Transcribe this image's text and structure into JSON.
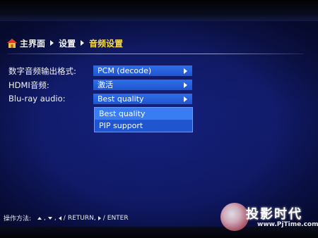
{
  "breadcrumb": {
    "items": [
      "主界面",
      "设置",
      "音频设置"
    ]
  },
  "settings": {
    "rows": [
      {
        "label": "数字音频输出格式:",
        "value": "PCM (decode)"
      },
      {
        "label": "HDMI音频:",
        "value": "激活"
      },
      {
        "label": "Blu-ray audio:",
        "value": "Best quality"
      }
    ]
  },
  "dropdown": {
    "options": [
      "Best quality",
      "PIP support"
    ],
    "selected": "Best quality"
  },
  "footer": {
    "label": "操作方法:",
    "return_text": "RETURN,",
    "enter_text": "ENTER"
  },
  "watermark": {
    "brand": "投影时代",
    "url": "www.PjTime.com"
  },
  "colors": {
    "background": "#101a66",
    "value_box": "#1f55cf",
    "highlight": "#3a7cf2",
    "current_crumb": "#f6d84a"
  },
  "icons": {
    "home": "home-icon",
    "row_arrow": "chevron-right-icon"
  }
}
